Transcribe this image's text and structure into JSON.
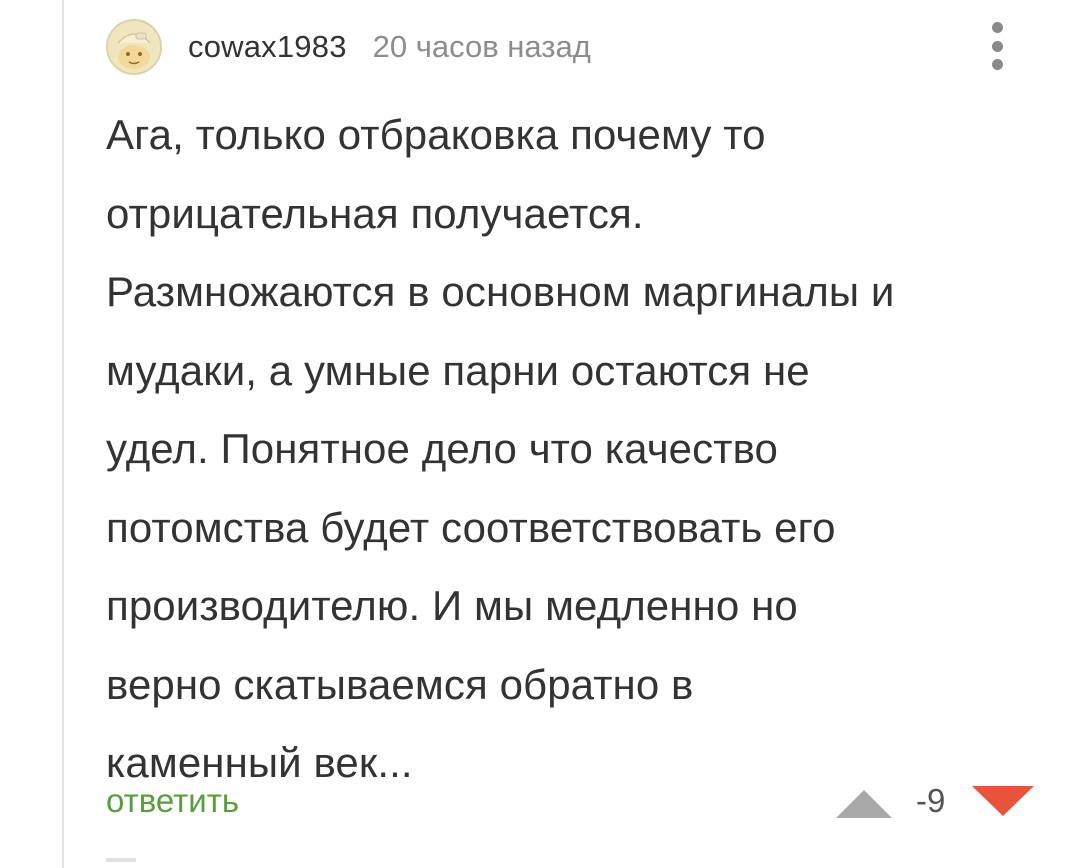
{
  "comment": {
    "author": "cowax1983",
    "time": "20 часов назад",
    "avatar_icon": "avatar-face-icon",
    "menu_icon": "more-vertical-icon",
    "text": "Ага, только отбраковка почему то\nотрицательная получается.\nРазмножаются в основном маргиналы и\nмудаки, а умные парни остаются не\nудел. Понятное дело что качество\nпотомства будет соответствовать его\nпроизводителю. И мы медленно но\nверно скатываемся обратно в\nкаменный век...",
    "actions": {
      "reply_label": "ответить",
      "rating": "-9",
      "upvote_icon": "triangle-up-icon",
      "downvote_icon": "triangle-down-icon"
    }
  },
  "colors": {
    "text": "#333333",
    "meta": "#8d8d8d",
    "reply": "#5a9d3f",
    "upvote": "#a8a8a8",
    "downvote": "#e8533c",
    "thread_line": "#e2e2e2"
  }
}
